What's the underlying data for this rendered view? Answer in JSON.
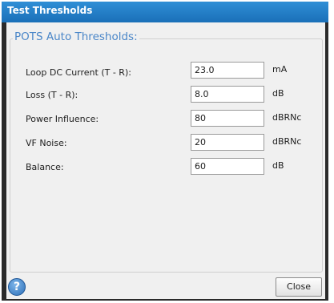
{
  "window": {
    "title": "Test Thresholds"
  },
  "group": {
    "title": "POTS Auto Thresholds:"
  },
  "fields": [
    {
      "label": "Loop DC Current (T - R):",
      "value": "23.0",
      "unit": "mA"
    },
    {
      "label": "Loss (T - R):",
      "value": "8.0",
      "unit": "dB"
    },
    {
      "label": "Power Influence:",
      "value": "80",
      "unit": "dBRNc"
    },
    {
      "label": "VF Noise:",
      "value": "20",
      "unit": "dBRNc"
    },
    {
      "label": "Balance:",
      "value": "60",
      "unit": "dB"
    }
  ],
  "footer": {
    "help_glyph": "?",
    "close_label": "Close"
  },
  "colors": {
    "title_bar": "#1f7cc6",
    "group_title": "#4a86c8",
    "panel": "#f0f0f0"
  }
}
